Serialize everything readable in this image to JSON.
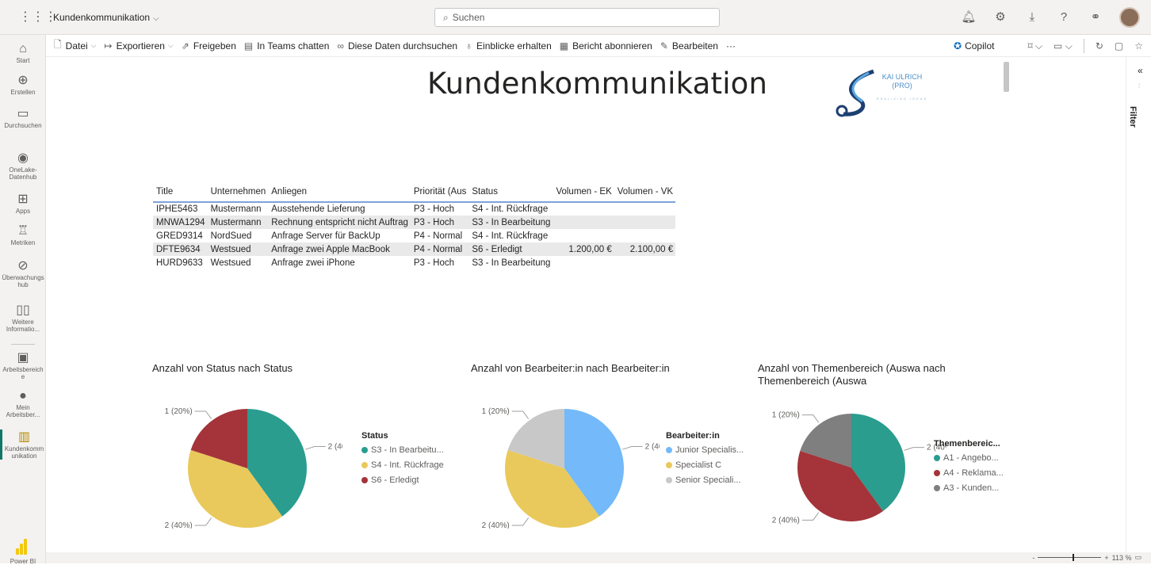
{
  "topbar": {
    "workspace": "Kundenkommunikation",
    "search_placeholder": "Suchen"
  },
  "nav": {
    "items": [
      {
        "label": "Start",
        "icon": "home-icon"
      },
      {
        "label": "Erstellen",
        "icon": "plus-circle-icon"
      },
      {
        "label": "Durchsuchen",
        "icon": "folder-icon"
      },
      {
        "label": "OneLake-Datenhub",
        "icon": "onelake-icon"
      },
      {
        "label": "Apps",
        "icon": "apps-icon"
      },
      {
        "label": "Metriken",
        "icon": "trophy-icon"
      },
      {
        "label": "Überwachungshub",
        "icon": "monitor-icon"
      },
      {
        "label": "Weitere Informatio...",
        "icon": "book-icon"
      },
      {
        "label": "Arbeitsbereiche",
        "icon": "workspaces-icon"
      },
      {
        "label": "Mein Arbeitsber...",
        "icon": "avatar-icon"
      },
      {
        "label": "Kundenkommunikation",
        "icon": "report-icon"
      }
    ],
    "footer": "Power BI"
  },
  "toolbar": {
    "datei": "Datei",
    "exportieren": "Exportieren",
    "freigeben": "Freigeben",
    "teams": "In Teams chatten",
    "durchsuchen": "Diese Daten durchsuchen",
    "einblicke": "Einblicke erhalten",
    "abonnieren": "Bericht abonnieren",
    "bearbeiten": "Bearbeiten",
    "more": "···",
    "copilot": "Copilot"
  },
  "report": {
    "title": "Kundenkommunikation",
    "logo_line1": "KAI ULRICH",
    "logo_line2": "(PRO)",
    "logo_tagline": "REALIZING IDEAS"
  },
  "table": {
    "headers": [
      "Title",
      "Unternehmen",
      "Anliegen",
      "Priorität (Aus",
      "Status",
      "Volumen - EK",
      "Volumen - VK"
    ],
    "rows": [
      [
        "IPHE5463",
        "Mustermann",
        "Ausstehende Lieferung",
        "P3 - Hoch",
        "S4 - Int. Rückfrage",
        "",
        ""
      ],
      [
        "MNWA1294",
        "Mustermann",
        "Rechnung entspricht nicht Auftrag",
        "P3 - Hoch",
        "S3 - In Bearbeitung",
        "",
        ""
      ],
      [
        "GRED9314",
        "NordSued",
        "Anfrage Server für BackUp",
        "P4 - Normal",
        "S4 - Int. Rückfrage",
        "",
        ""
      ],
      [
        "DFTE9634",
        "Westsued",
        "Anfrage zwei Apple MacBook",
        "P4 - Normal",
        "S6 - Erledigt",
        "1.200,00 €",
        "2.100,00 €"
      ],
      [
        "HURD9633",
        "Westsued",
        "Anfrage zwei iPhone",
        "P3 - Hoch",
        "S3 - In Bearbeitung",
        "",
        ""
      ]
    ]
  },
  "chart_data": [
    {
      "type": "pie",
      "title": "Anzahl von Status nach Status",
      "legend_title": "Status",
      "categories": [
        "S3 - In Bearbeitu...",
        "S4 - Int. Rückfrage",
        "S6 - Erledigt"
      ],
      "values": [
        2,
        2,
        1
      ],
      "percent": [
        40,
        40,
        20
      ],
      "data_labels": [
        "2 (40%)",
        "2 (40%)",
        "1 (20%)"
      ],
      "colors": [
        "#2a9d8f",
        "#e9c95b",
        "#a4343a"
      ]
    },
    {
      "type": "pie",
      "title": "Anzahl von Bearbeiter:in nach Bearbeiter:in",
      "legend_title": "Bearbeiter:in",
      "categories": [
        "Junior Specialis...",
        "Specialist C",
        "Senior Speciali..."
      ],
      "values": [
        2,
        2,
        1
      ],
      "percent": [
        40,
        40,
        20
      ],
      "data_labels": [
        "2 (40%)",
        "2 (40%)",
        "1 (20%)"
      ],
      "colors": [
        "#74b9f9",
        "#e9c95b",
        "#c8c8c8"
      ]
    },
    {
      "type": "pie",
      "title": "Anzahl von Themenbereich (Auswa nach Themenbereich (Auswa",
      "legend_title": "Themenbereic...",
      "categories": [
        "A1 - Angebo...",
        "A4 - Reklama...",
        "A3 - Kunden..."
      ],
      "values": [
        2,
        2,
        1
      ],
      "percent": [
        40,
        40,
        20
      ],
      "data_labels": [
        "2 (40%)",
        "2 (40%)",
        "1 (20%)"
      ],
      "colors": [
        "#2a9d8f",
        "#a4343a",
        "#7f7f7f"
      ]
    }
  ],
  "filter": {
    "label": "Filter"
  },
  "status": {
    "zoom": "113 %"
  }
}
